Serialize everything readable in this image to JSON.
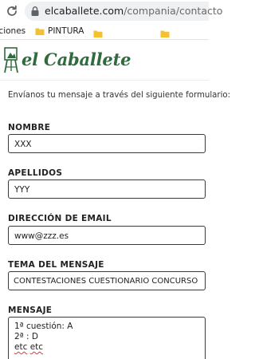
{
  "browser": {
    "url_domain": "elcaballete.com",
    "url_path": "/compania/contacto",
    "bookmarks": [
      {
        "label": "aciones",
        "icon": "none"
      },
      {
        "label": "PINTURA",
        "icon": "folder-icon"
      },
      {
        "label": "",
        "icon": "folder-icon"
      },
      {
        "label": "",
        "icon": "folder-icon"
      }
    ],
    "colors": {
      "folder": "#f2c230",
      "pill": "#eef0f2"
    }
  },
  "site": {
    "brand": "el Caballete",
    "brand_color": "#2f6b3d"
  },
  "form": {
    "intro": "Envíanos tu mensaje a través del siguiente formulario:",
    "nombre": {
      "label": "NOMBRE",
      "value": "XXX"
    },
    "apellidos": {
      "label": "APELLIDOS",
      "value": "YYY"
    },
    "email": {
      "label": "DIRECCIÓN DE EMAIL",
      "value": "www@zzz.es"
    },
    "tema": {
      "label": "TEMA DEL MENSAJE",
      "value": "CONTESTACIONES  CUESTIONARIO CONCURSO"
    },
    "mensaje": {
      "label": "MENSAJE",
      "line1": "1ª cuestión:  A",
      "line2": "2ª :  D",
      "line3_a": "etc",
      "line3_b": "etc"
    }
  }
}
